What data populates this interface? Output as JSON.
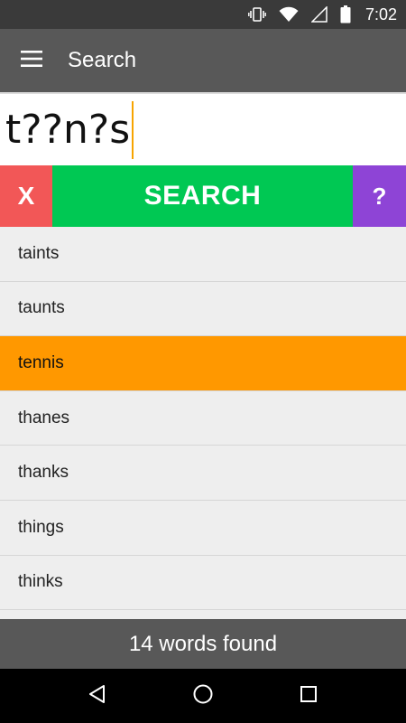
{
  "status_bar": {
    "time": "7:02",
    "icons": [
      "vibrate-icon",
      "wifi-icon",
      "cell-signal-icon",
      "battery-icon"
    ]
  },
  "app_bar": {
    "title": "Search",
    "menu_icon": "hamburger-menu-icon"
  },
  "search": {
    "query": "t??n?s"
  },
  "buttons": {
    "clear_label": "X",
    "search_label": "SEARCH",
    "help_label": "?"
  },
  "results": {
    "items": [
      "taints",
      "taunts",
      "tennis",
      "thanes",
      "thanks",
      "things",
      "thinks"
    ],
    "selected_index": 2
  },
  "footer": {
    "status": "14 words found"
  },
  "nav_bar": {
    "icons": [
      "back-icon",
      "home-icon",
      "recents-icon"
    ]
  },
  "colors": {
    "status_bar": "#3a3a3a",
    "app_bar": "#585858",
    "clear": "#f25757",
    "search": "#00c853",
    "help": "#8e44d6",
    "selected": "#ff9800",
    "caret": "#f7a400"
  }
}
